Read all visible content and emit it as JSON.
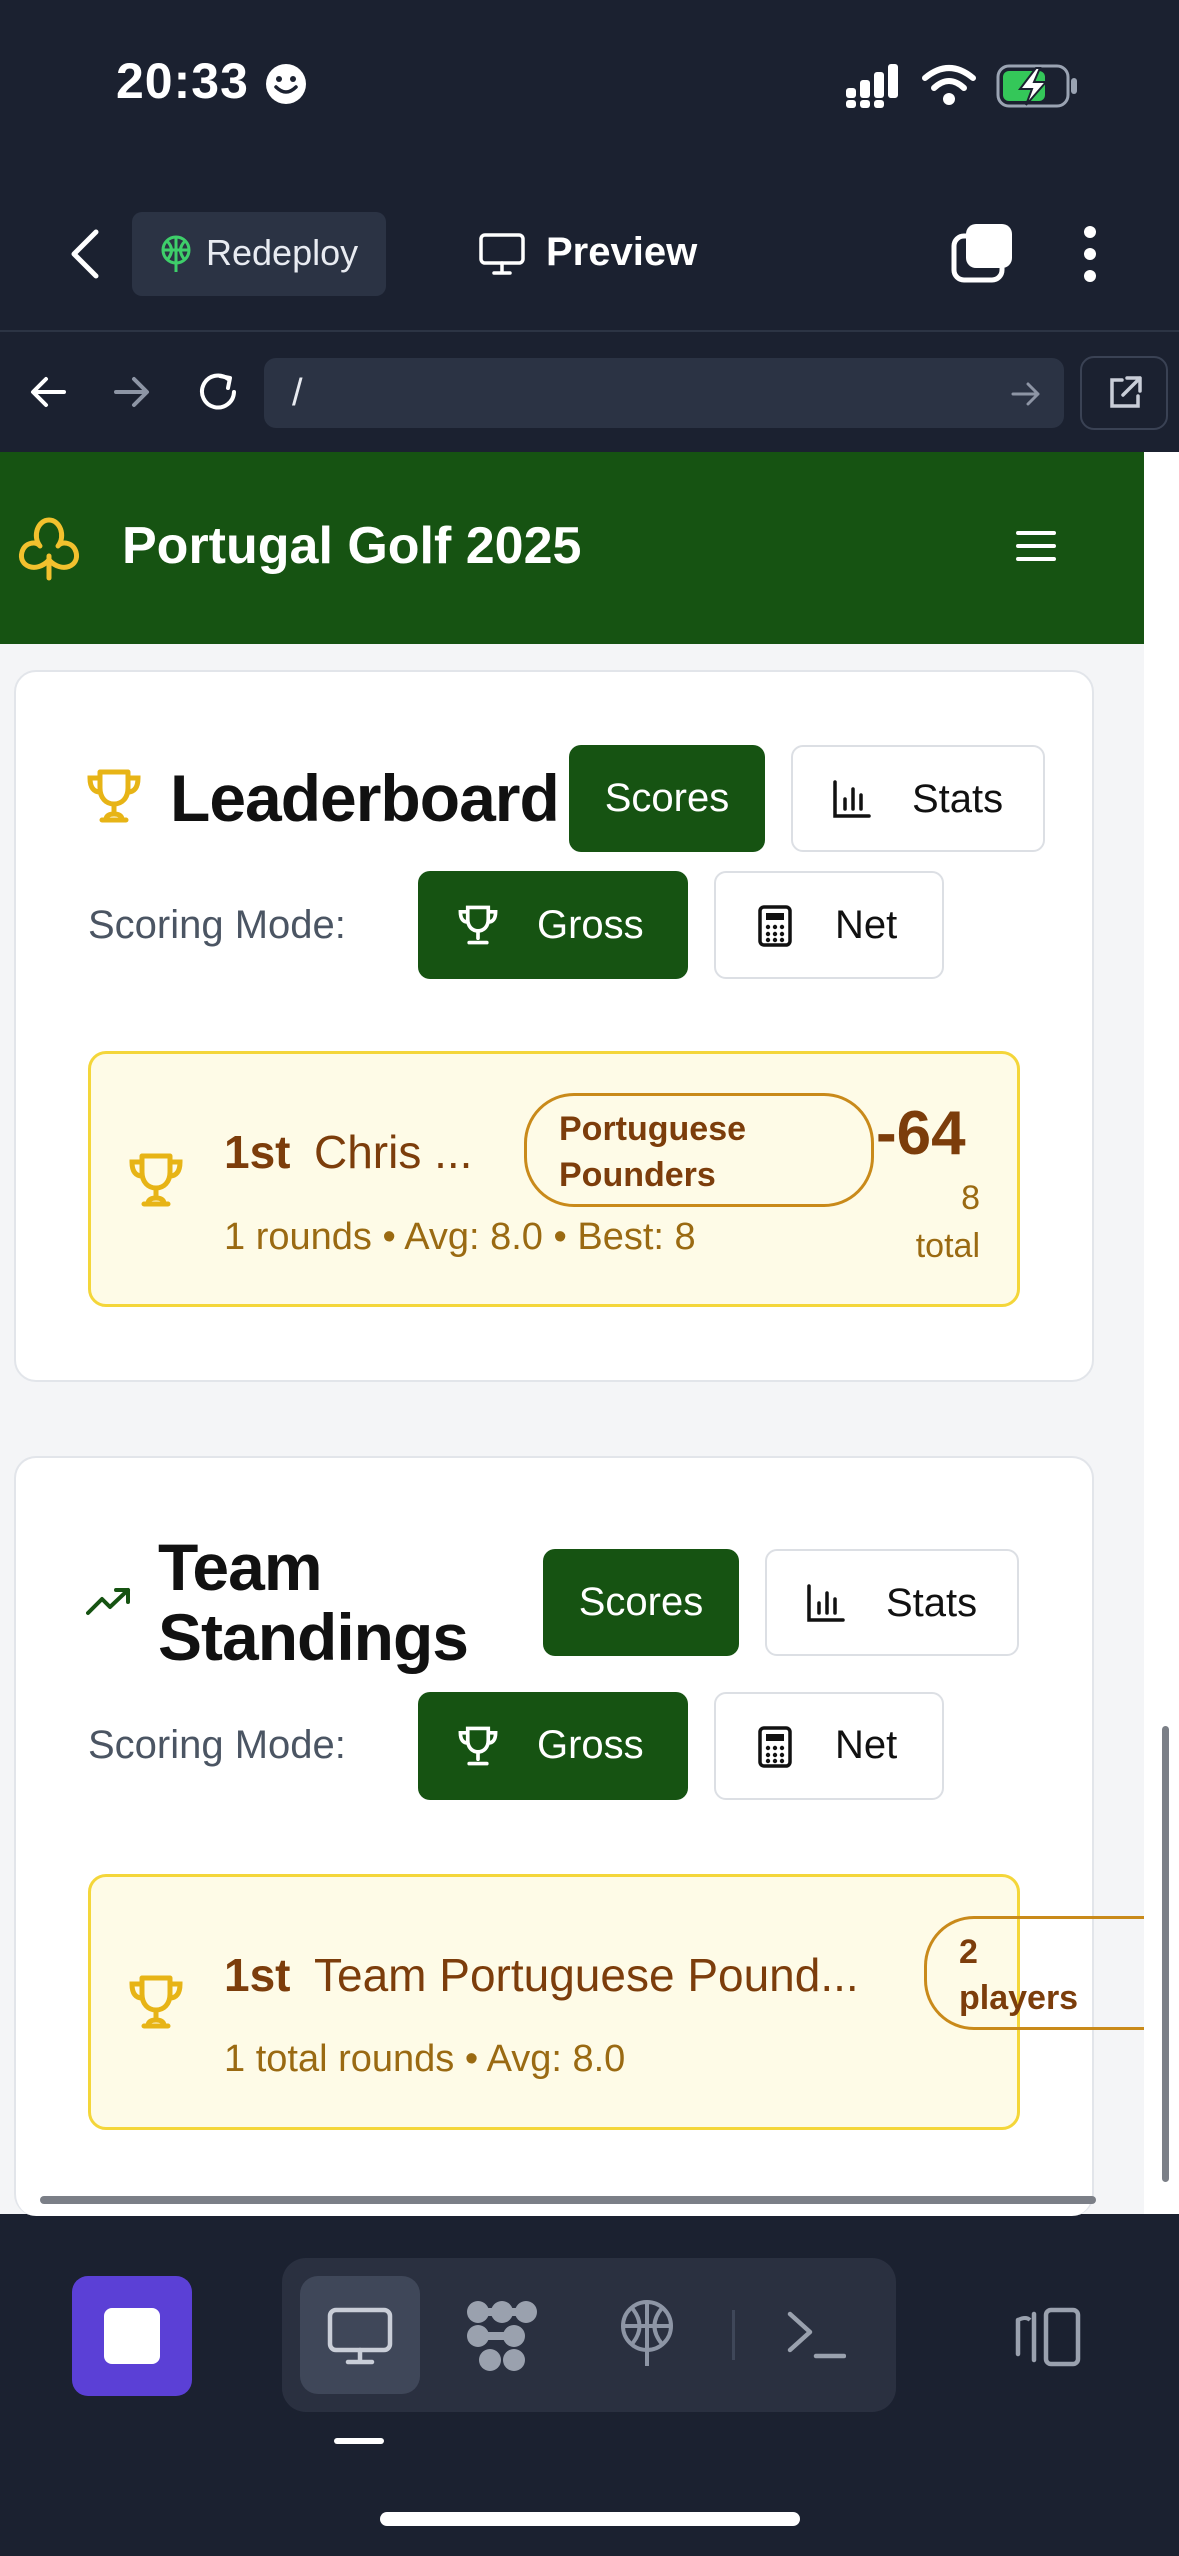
{
  "status_bar": {
    "time": "20:33"
  },
  "toolbar": {
    "redeploy_label": "Redeploy",
    "preview_label": "Preview"
  },
  "url_bar": {
    "path": "/"
  },
  "app": {
    "title": "Portugal Golf 2025"
  },
  "leaderboard": {
    "title": "Leaderboard",
    "scores_label": "Scores",
    "stats_label": "Stats",
    "scoring_mode_label": "Scoring Mode:",
    "gross_label": "Gross",
    "net_label": "Net",
    "entry": {
      "rank": "1st",
      "name": "Chris ...",
      "team_line1": "Portuguese",
      "team_line2": "Pounders",
      "summary": "1 rounds • Avg: 8.0 • Best: 8",
      "score": "-64",
      "total_value": "8",
      "total_label": "total"
    }
  },
  "team_standings": {
    "title_line1": "Team",
    "title_line2": "Standings",
    "scores_label": "Scores",
    "stats_label": "Stats",
    "scoring_mode_label": "Scoring Mode:",
    "gross_label": "Gross",
    "net_label": "Net",
    "entry": {
      "rank": "1st",
      "name": "Team Portuguese Pound...",
      "players_line1": "2",
      "players_line2": "players",
      "summary": "1 total rounds • Avg: 8.0"
    }
  },
  "colors": {
    "brand_green": "#165312",
    "gold": "#e7b416",
    "entry_bg": "#fefbe7",
    "accent_purple": "#5b40d6"
  }
}
